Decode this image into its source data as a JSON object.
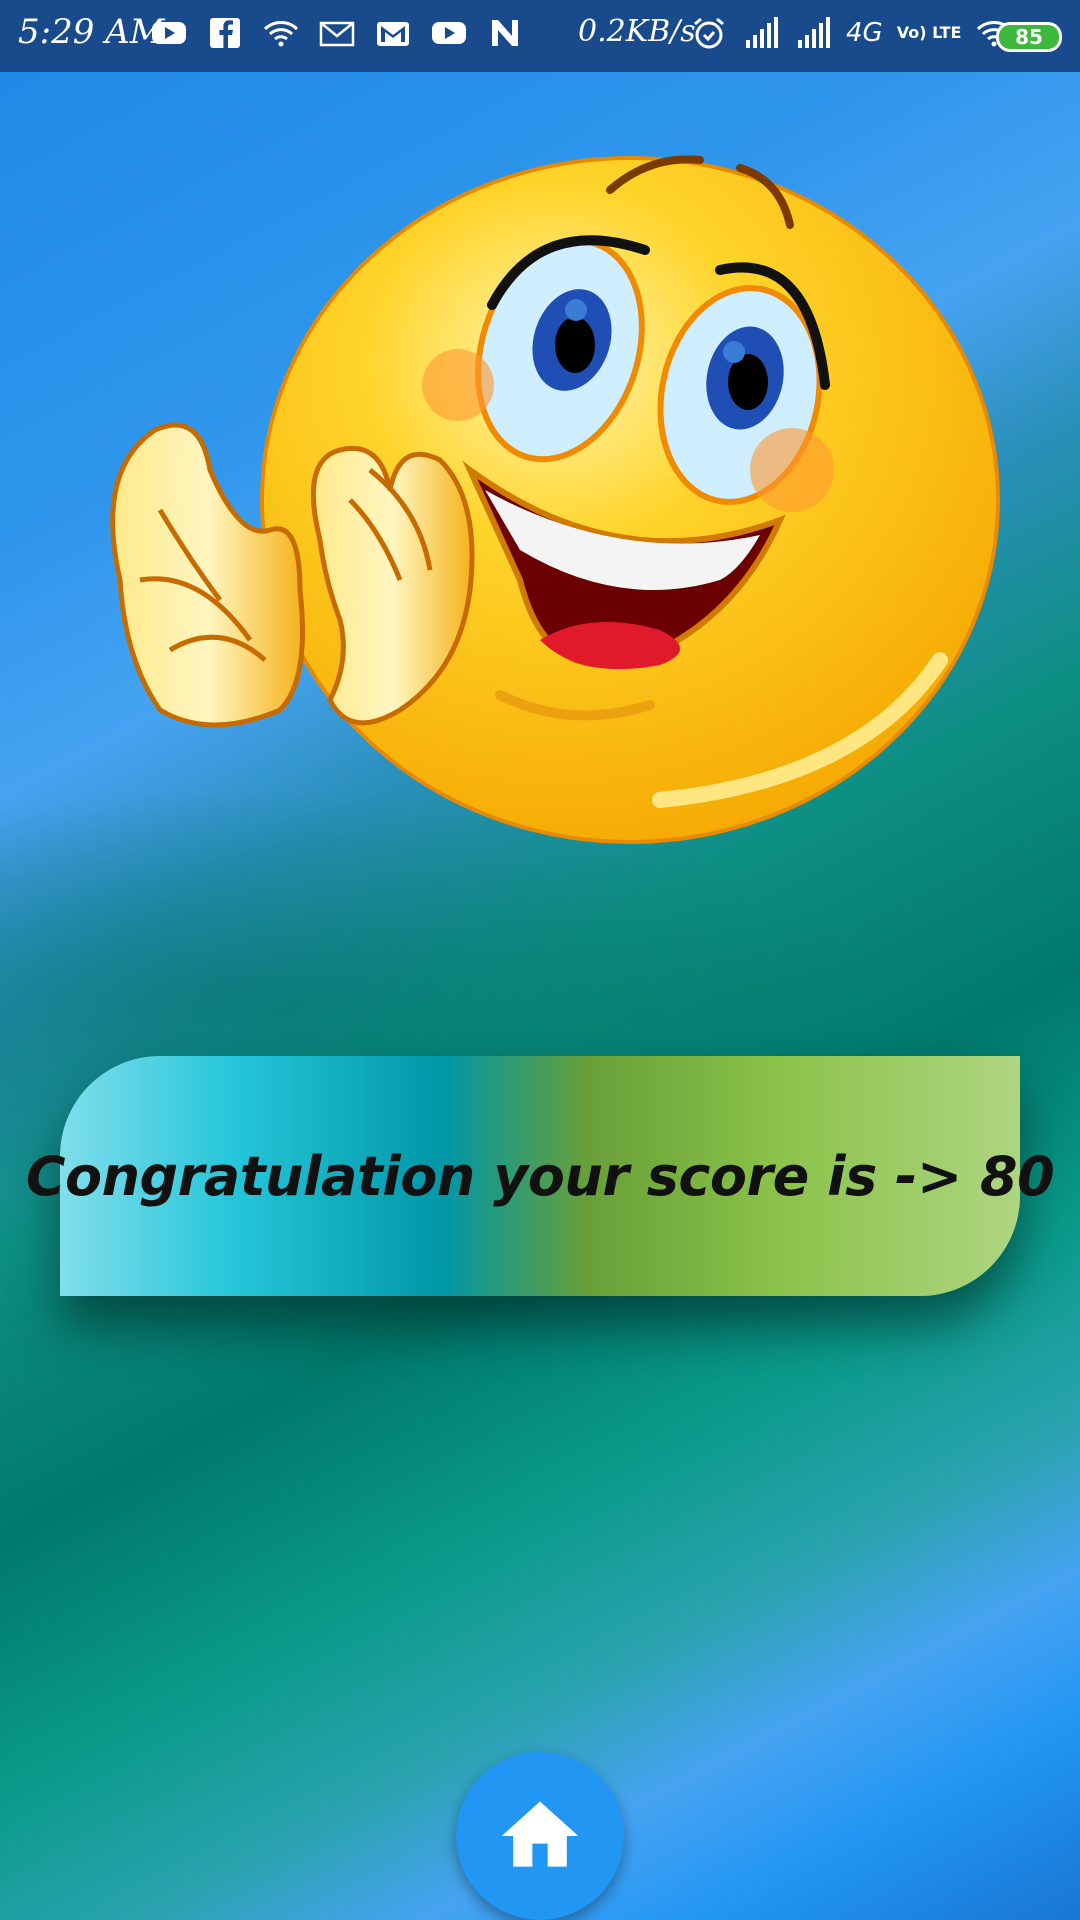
{
  "status_bar": {
    "time": "5:29 AM",
    "network_speed": "0.2KB/s",
    "network_type": "4G",
    "volte": "Vo) LTE",
    "battery": "85",
    "notification_icons": [
      "youtube-icon",
      "facebook-icon",
      "wifi-icon",
      "mail-icon",
      "gmail-icon",
      "youtube-icon",
      "n-icon"
    ]
  },
  "result": {
    "message": "Congratulation your score is -> 80"
  },
  "home_button": {
    "icon": "home-icon"
  },
  "colors": {
    "status_bar": "#184a8c",
    "home_button": "#2196f3",
    "card_gradient": [
      "#80deea",
      "#0097a7",
      "#689f38",
      "#aed581"
    ]
  }
}
